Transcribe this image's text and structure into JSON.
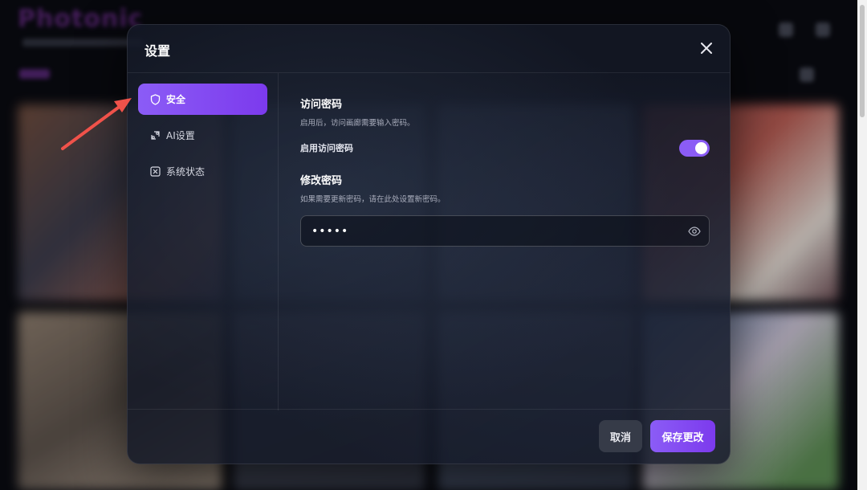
{
  "background": {
    "logo_text": "Photonic"
  },
  "modal": {
    "title": "设置",
    "sidebar": {
      "items": [
        {
          "label": "安全",
          "icon": "shield-icon",
          "active": true
        },
        {
          "label": "AI设置",
          "icon": "ai-settings-icon",
          "active": false
        },
        {
          "label": "系统状态",
          "icon": "system-status-icon",
          "active": false
        }
      ]
    },
    "access_password": {
      "title": "访问密码",
      "description": "启用后，访问画廊需要输入密码。",
      "toggle_label": "启用访问密码",
      "toggle_on": true
    },
    "change_password": {
      "title": "修改密码",
      "description": "如果需要更新密码，请在此处设置新密码。",
      "value": "•••••"
    },
    "footer": {
      "cancel_label": "取消",
      "save_label": "保存更改"
    }
  },
  "colors": {
    "accent": "#8b5cf6",
    "arrow": "#f0524a"
  }
}
